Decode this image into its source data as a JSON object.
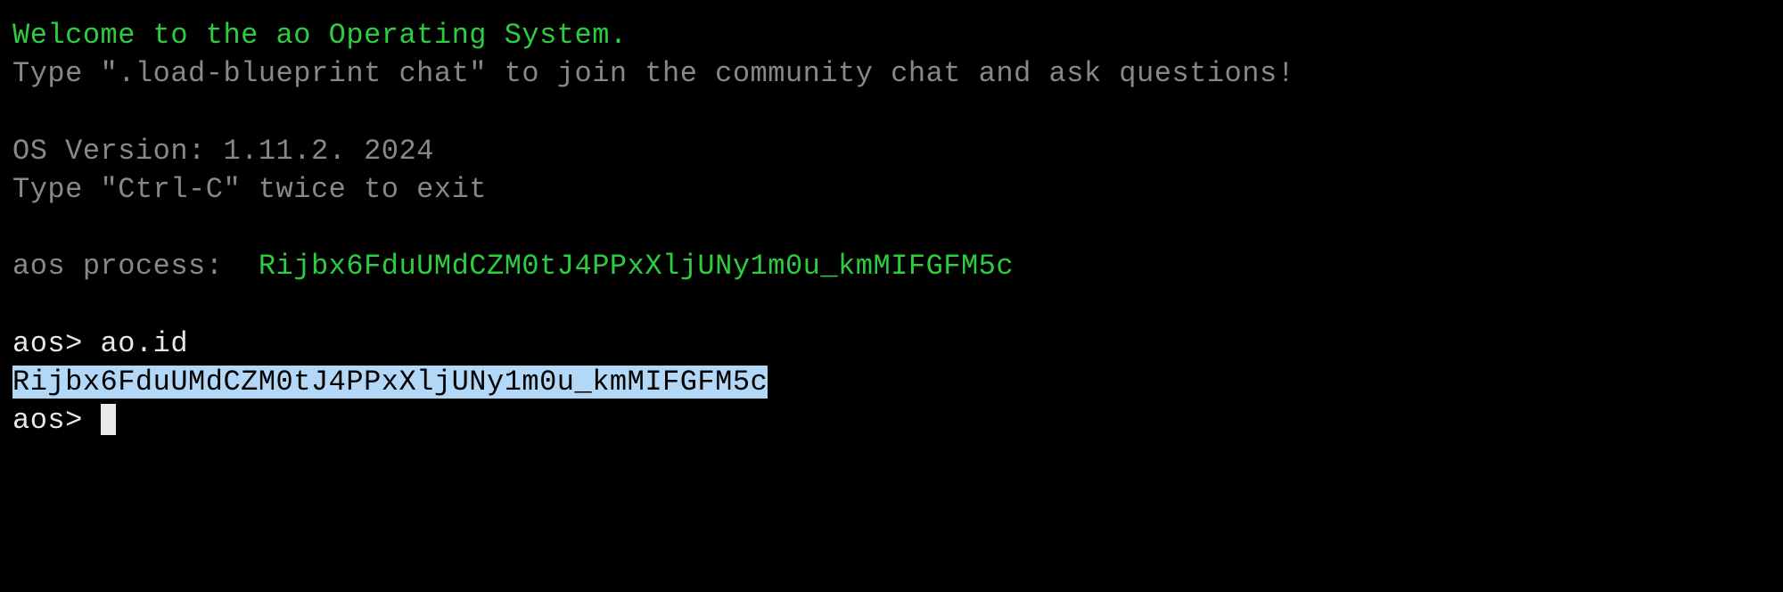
{
  "terminal": {
    "welcome": "Welcome to the ao Operating System.",
    "instruction1": "Type \".load-blueprint chat\" to join the community chat and ask questions!",
    "version": "OS Version: 1.11.2. 2024",
    "exit_instruction": "Type \"Ctrl-C\" twice to exit",
    "process_label": "aos process:  ",
    "process_id": "Rijbx6FduUMdCZM0tJ4PPxXljUNy1m0u_kmMIFGFM5c",
    "prompt1": "aos> ",
    "command1": "ao.id",
    "output1": "Rijbx6FduUMdCZM0tJ4PPxXljUNy1m0u_kmMIFGFM5c",
    "prompt2": "aos> "
  }
}
